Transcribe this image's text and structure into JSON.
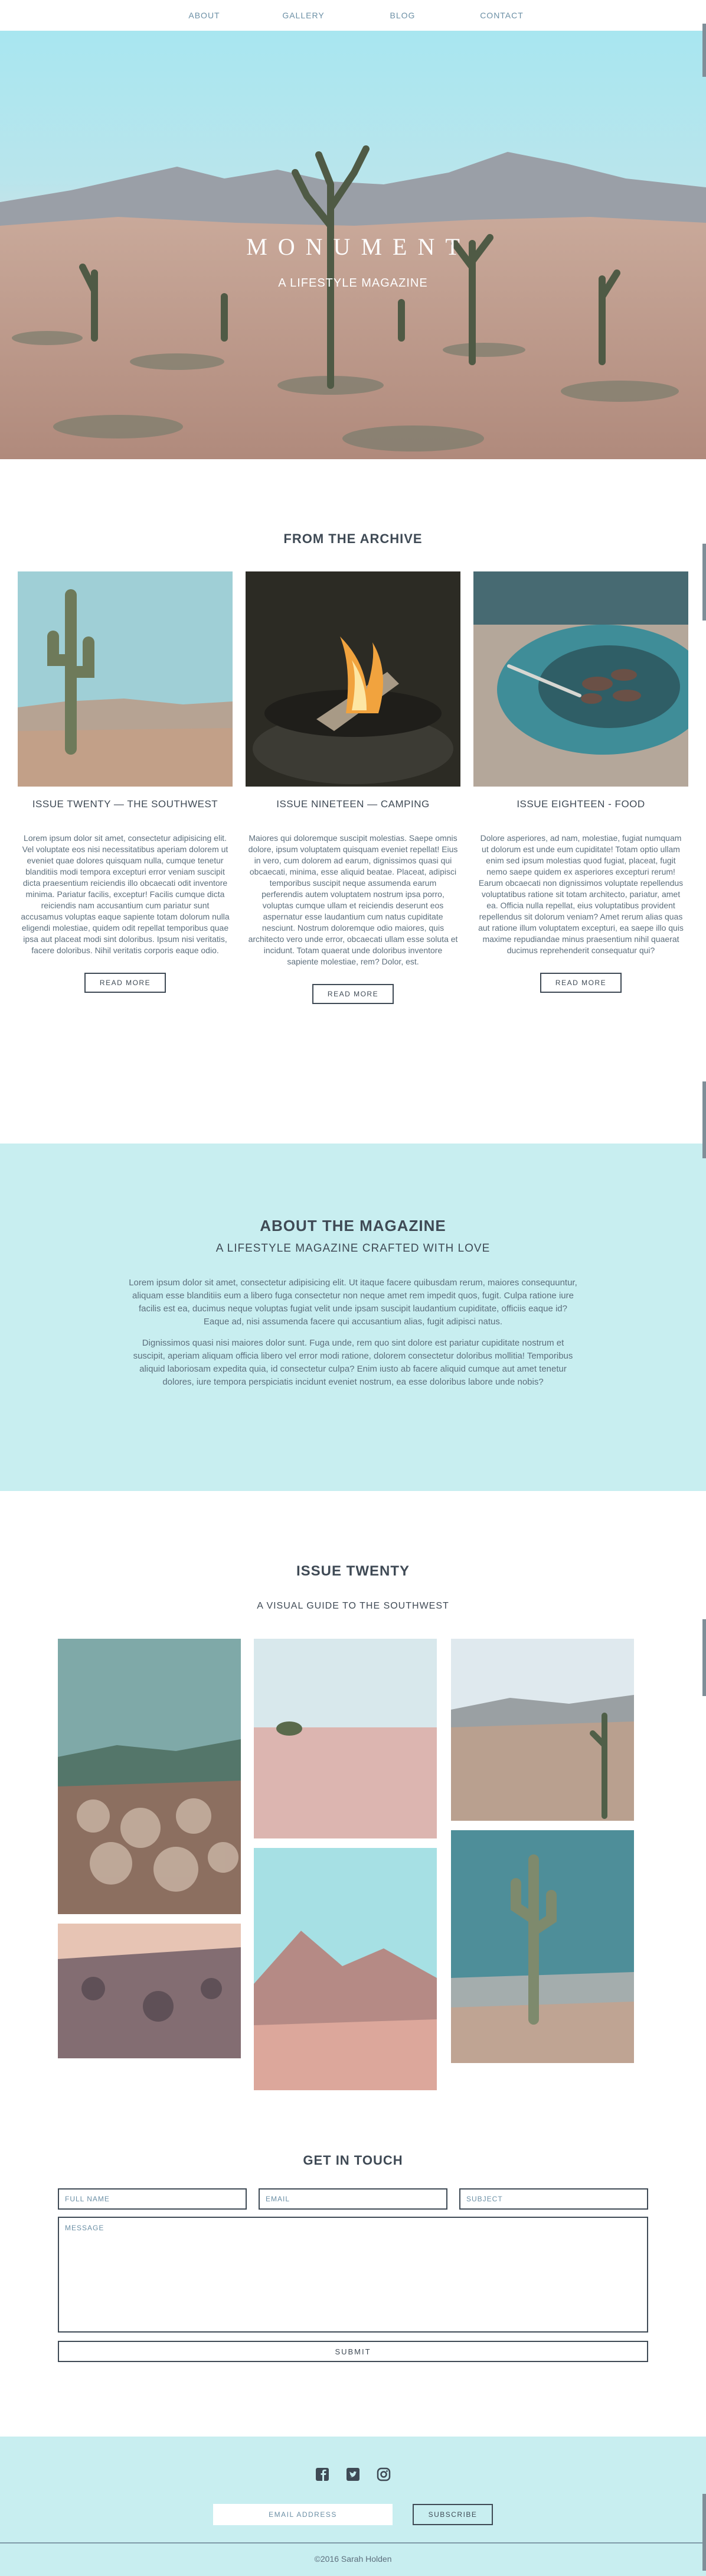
{
  "nav": {
    "items": [
      "ABOUT",
      "GALLERY",
      "BLOG",
      "CONTACT"
    ]
  },
  "hero": {
    "title": "MONUMENT",
    "subtitle": "A LIFESTYLE MAGAZINE"
  },
  "archive": {
    "title": "FROM THE ARCHIVE",
    "cards": [
      {
        "heading": "ISSUE TWENTY — THE SOUTHWEST",
        "body": "Lorem ipsum dolor sit amet, consectetur adipisicing elit. Vel voluptate eos nisi necessitatibus aperiam dolorem ut eveniet quae dolores quisquam nulla, cumque tenetur blanditiis modi tempora excepturi error veniam suscipit dicta praesentium reiciendis illo obcaecati odit inventore minima. Pariatur facilis, exceptur! Facilis cumque dicta reiciendis nam accusantium cum pariatur sunt accusamus voluptas eaque sapiente totam dolorum nulla eligendi molestiae, quidem odit repellat temporibus quae ipsa aut placeat modi sint doloribus. Ipsum nisi veritatis, facere doloribus. Nihil veritatis corporis eaque odio.",
        "button": "READ MORE"
      },
      {
        "heading": "ISSUE NINETEEN — CAMPING",
        "body": "Maiores qui doloremque suscipit molestias. Saepe omnis dolore, ipsum voluptatem quisquam eveniet repellat! Eius in vero, cum dolorem ad earum, dignissimos quasi qui obcaecati, minima, esse aliquid beatae. Placeat, adipisci temporibus suscipit neque assumenda earum perferendis autem voluptatem nostrum ipsa porro, voluptas cumque ullam et reiciendis deserunt eos aspernatur esse laudantium cum natus cupiditate nesciunt. Nostrum doloremque odio maiores, quis architecto vero unde error, obcaecati ullam esse soluta et incidunt. Totam quaerat unde doloribus inventore sapiente molestiae, rem? Dolor, est.",
        "button": "READ MORE"
      },
      {
        "heading": "ISSUE EIGHTEEN - FOOD",
        "body": "Dolore asperiores, ad nam, molestiae, fugiat numquam ut dolorum est unde eum cupiditate! Totam optio ullam enim sed ipsum molestias quod fugiat, placeat, fugit nemo saepe quidem ex asperiores excepturi rerum! Earum obcaecati non dignissimos voluptate repellendus voluptatibus ratione sit totam architecto, pariatur, amet ea. Officia nulla repellat, eius voluptatibus provident repellendus sit dolorum veniam? Amet rerum alias quas aut ratione illum voluptatem excepturi, ea saepe illo quis maxime repudiandae minus praesentium nihil quaerat ducimus reprehenderit consequatur qui?",
        "button": "READ MORE"
      }
    ]
  },
  "about": {
    "title": "ABOUT THE MAGAZINE",
    "tagline": "A LIFESTYLE MAGAZINE CRAFTED WITH LOVE",
    "paragraphs": [
      "Lorem ipsum dolor sit amet, consectetur adipisicing elit. Ut itaque facere quibusdam rerum, maiores consequuntur, aliquam esse blanditiis eum a libero fuga consectetur non neque amet rem impedit quos, fugit. Culpa ratione iure facilis est ea, ducimus neque voluptas fugiat velit unde ipsam suscipit laudantium cupiditate, officiis eaque id? Eaque ad, nisi assumenda facere qui accusantium alias, fugit adipisci natus.",
      "Dignissimos quasi nisi maiores dolor sunt. Fuga unde, rem quo sint dolore est pariatur cupiditate nostrum et suscipit, aperiam aliquam officia libero vel error modi ratione, dolorem consectetur doloribus mollitia! Temporibus aliquid laboriosam expedita quia, id consectetur culpa? Enim iusto ab facere aliquid cumque aut amet tenetur dolores, iure tempora perspiciatis incidunt eveniet nostrum, ea esse doloribus labore unde nobis?"
    ]
  },
  "issue": {
    "title": "ISSUE TWENTY",
    "kicker": "A VISUAL GUIDE TO THE SOUTHWEST"
  },
  "contact": {
    "title": "GET IN TOUCH",
    "name_placeholder": "FULL NAME",
    "email_placeholder": "EMAIL",
    "subject_placeholder": "SUBJECT",
    "message_placeholder": "MESSAGE",
    "submit": "SUBMIT"
  },
  "footer": {
    "social_icons": [
      "facebook-icon",
      "twitter-icon",
      "instagram-icon"
    ],
    "email_placeholder": "EMAIL ADDRESS",
    "subscribe": "SUBSCRIBE",
    "copyright": "©2016 Sarah Holden"
  },
  "colors": {
    "accent_bg": "#c8eef0",
    "text_dark": "#3f4a55",
    "text_muted": "#5d6f7d",
    "nav_link": "#6b8fa5"
  }
}
